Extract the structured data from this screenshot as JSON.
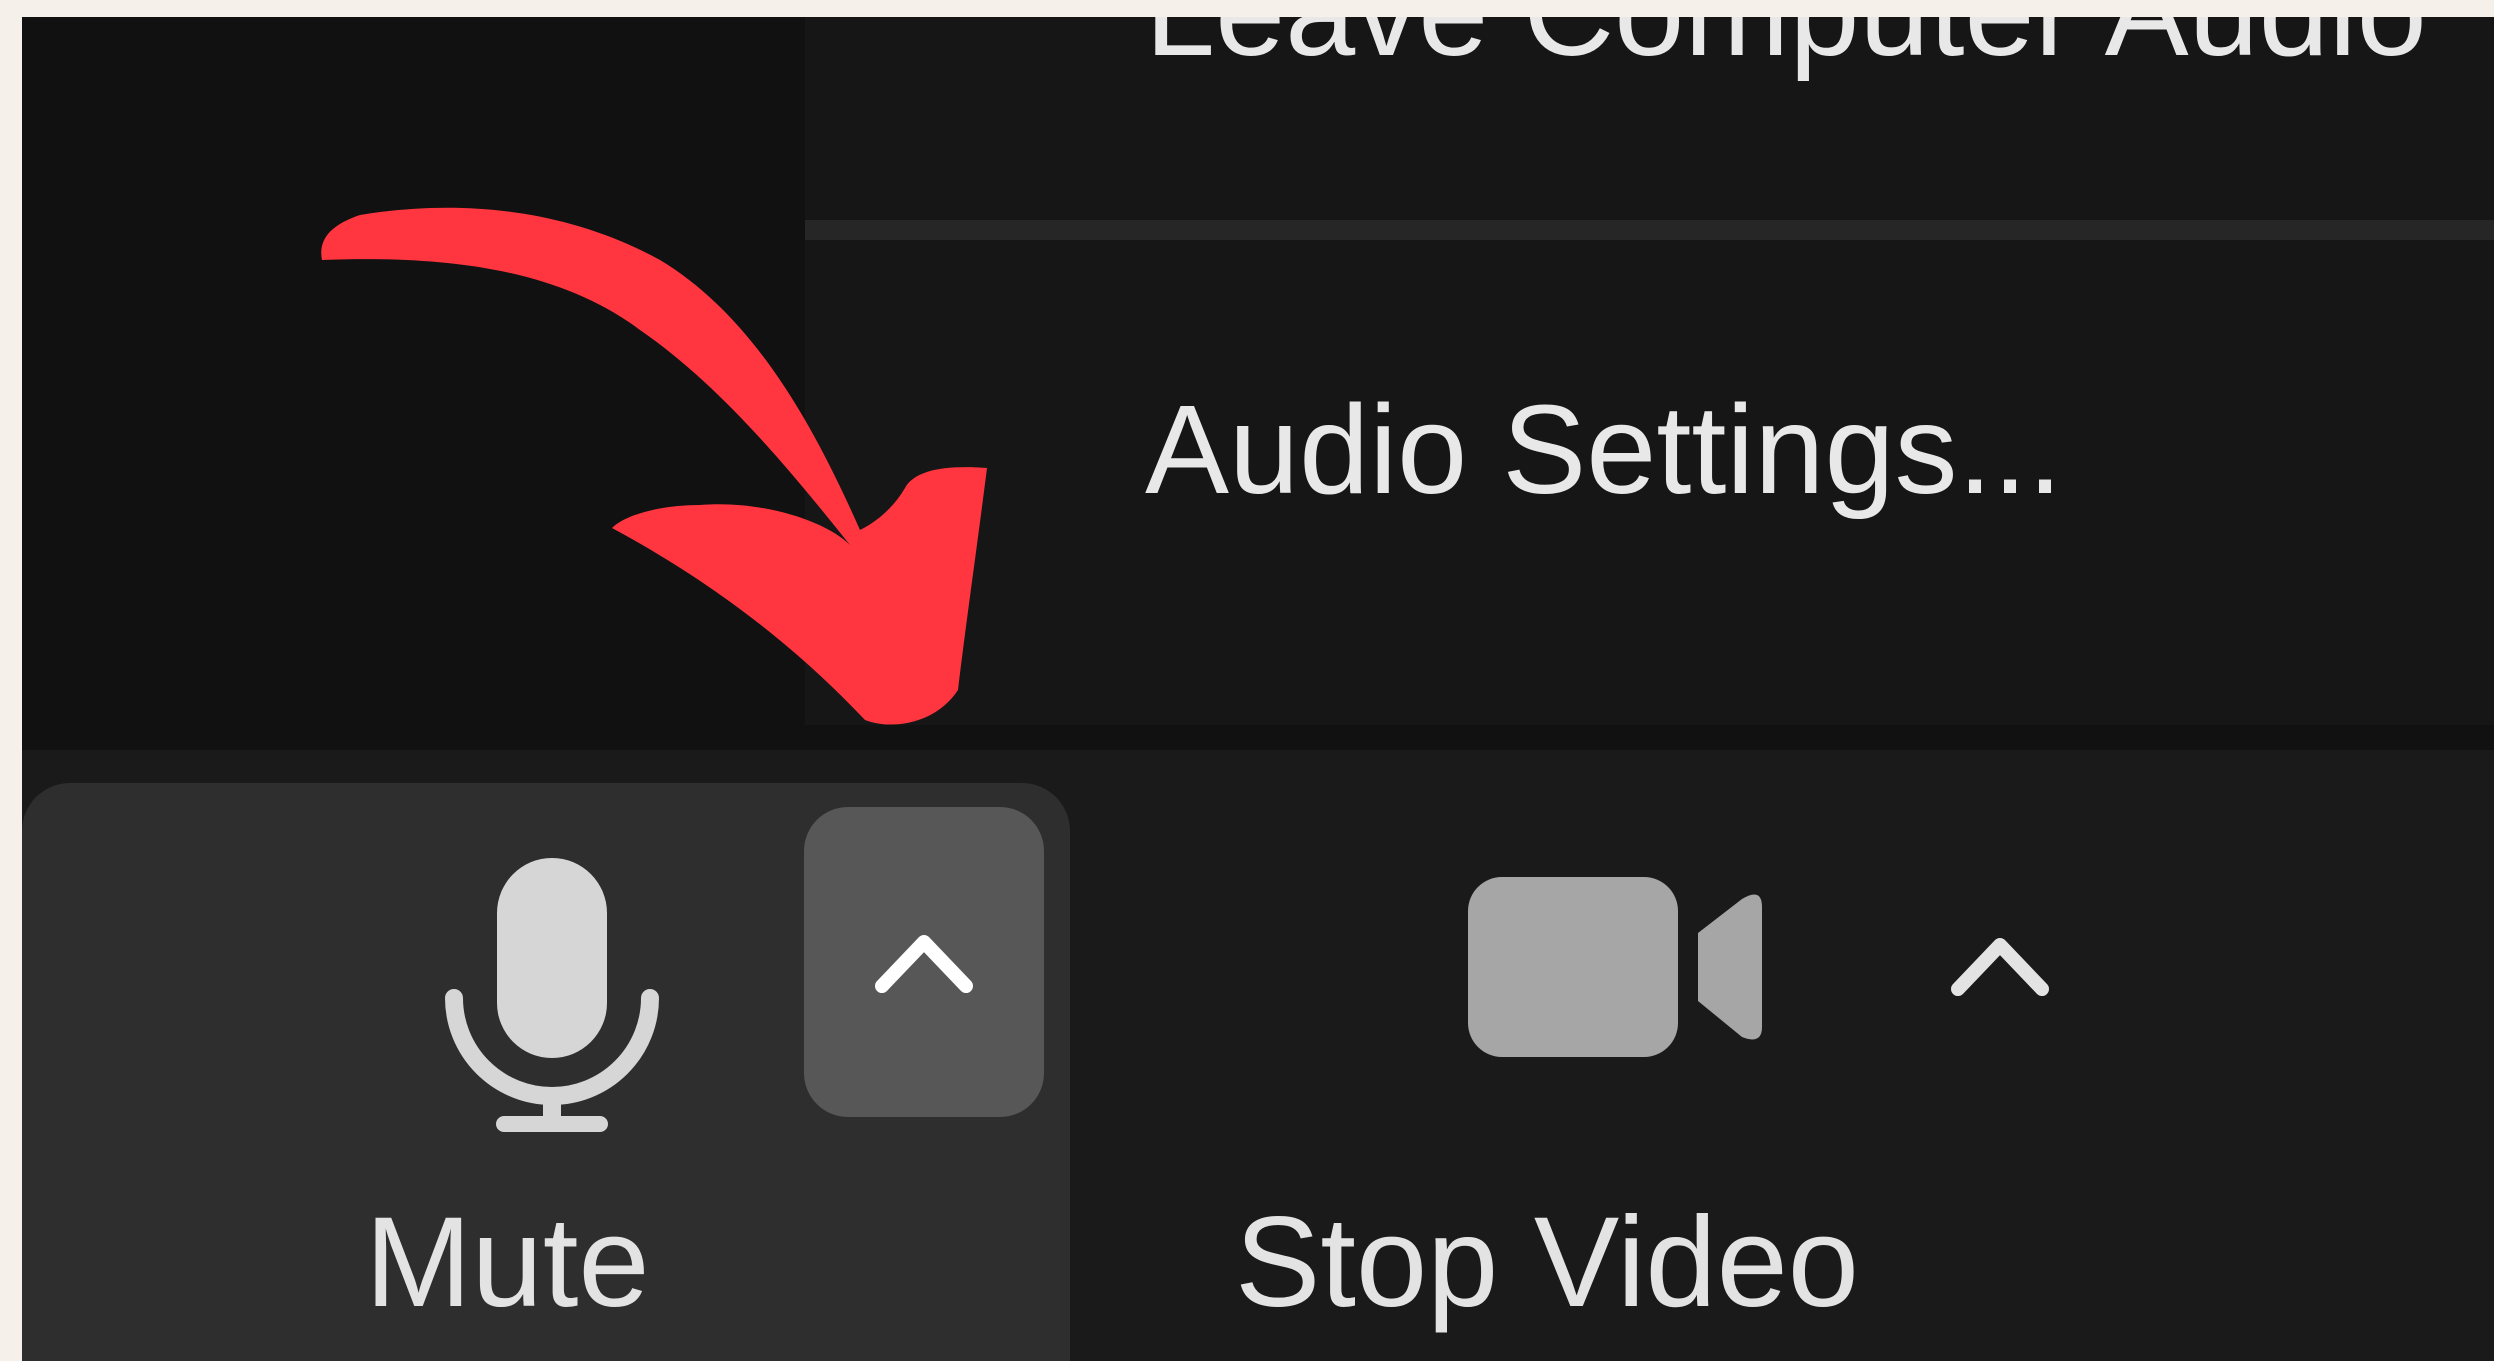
{
  "menu": {
    "items": [
      {
        "label": "Leave Computer Audio"
      },
      {
        "label": "Audio Settings..."
      }
    ]
  },
  "toolbar": {
    "mute_label": "Mute",
    "stop_video_label": "Stop Video"
  },
  "icons": {
    "mic": "microphone-icon",
    "audio_options": "chevron-up-icon",
    "camera": "video-camera-icon",
    "video_options": "chevron-up-icon",
    "annotation": "arrow-annotation"
  },
  "colors": {
    "annotation_arrow": "#ff3640",
    "menu_background": "#161616",
    "toolbar_background": "#1a1a1a",
    "mute_group_background": "#2e2e2e",
    "caret_button_background": "#575757",
    "text": "#e8e8e8",
    "page_background": "#f5f1ea"
  }
}
